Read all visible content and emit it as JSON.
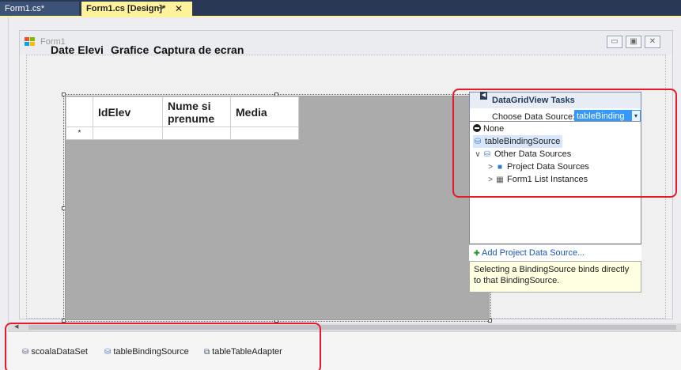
{
  "document_tabs": {
    "inactive_label": "Form1.cs*",
    "active_label": "Form1.cs [Design]*",
    "pin_glyph": "⊸",
    "close_glyph": "✕"
  },
  "form": {
    "title": "Form1",
    "minimize_glyph": "▭",
    "maximize_glyph": "▣",
    "close_glyph": "✕"
  },
  "tab_control": {
    "tabs": [
      "Date Elevi",
      "Grafice",
      "Captura de ecran"
    ]
  },
  "grid": {
    "columns": [
      "IdElev",
      "Nume si prenume",
      "Media"
    ],
    "new_row_marker": "*"
  },
  "tasks_panel": {
    "title": "DataGridView Tasks",
    "choose_label": "Choose Data Source:",
    "selected_value": "tableBinding",
    "dropdown_glyph": "▾",
    "items": [
      {
        "label": "None",
        "icon": "none-icon"
      },
      {
        "label": "tableBindingSource",
        "icon": "binding-source-icon"
      },
      {
        "label": "Other Data Sources",
        "icon": "data-sources-icon",
        "expander": "∨"
      },
      {
        "label": "Project Data Sources",
        "icon": "database-icon",
        "expander": ">"
      },
      {
        "label": "Form1 List Instances",
        "icon": "form-list-icon",
        "expander": ">"
      }
    ],
    "add_link": "Add Project Data Source...",
    "tip": "Selecting a BindingSource binds directly to that BindingSource."
  },
  "component_tray": {
    "items": [
      {
        "label": "scoalaDataSet",
        "icon": "dataset-icon"
      },
      {
        "label": "tableBindingSource",
        "icon": "binding-source-icon"
      },
      {
        "label": "tableTableAdapter",
        "icon": "table-adapter-icon"
      }
    ]
  },
  "colors": {
    "tab_bar": "#293955",
    "active_tab": "#fff29d",
    "highlight": "#3399ff",
    "annotation_red": "#e8192c",
    "grid_background": "#ababab"
  }
}
